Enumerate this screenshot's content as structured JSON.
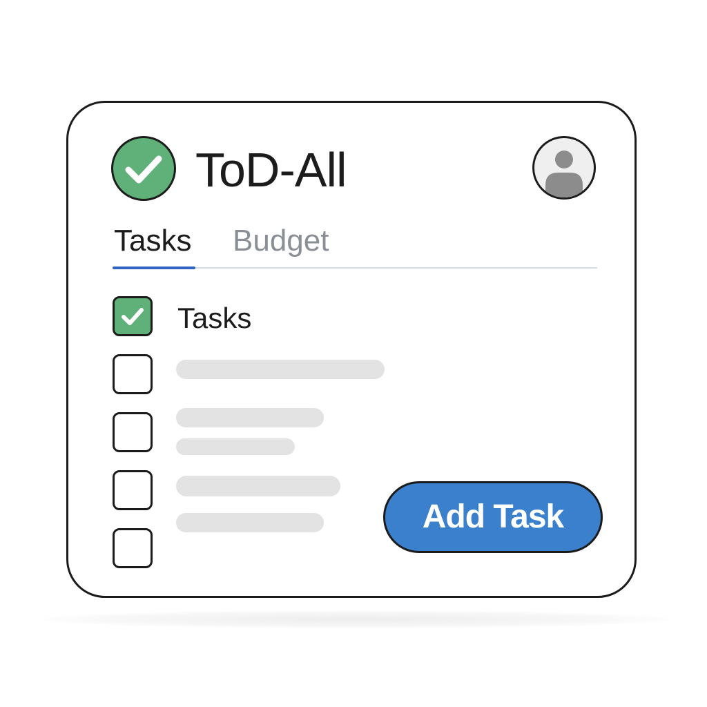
{
  "app": {
    "title": "ToD-All",
    "logo_icon": "check-circle-icon",
    "avatar_icon": "user-avatar-icon"
  },
  "tabs": [
    {
      "label": "Tasks",
      "active": true
    },
    {
      "label": "Budget",
      "active": false
    }
  ],
  "task_list": {
    "items": [
      {
        "label": "Tasks",
        "checked": true
      },
      {
        "label": "",
        "checked": false
      },
      {
        "label": "",
        "checked": false
      },
      {
        "label": "",
        "checked": false
      },
      {
        "label": "",
        "checked": false
      }
    ]
  },
  "actions": {
    "add_task_label": "Add Task"
  },
  "colors": {
    "accent_green": "#5fb179",
    "accent_blue": "#3a80cc",
    "tab_indicator": "#2f64c2",
    "skeleton": "#e3e3e3",
    "text_primary": "#1c1c1c",
    "text_muted": "#8a8f96"
  }
}
